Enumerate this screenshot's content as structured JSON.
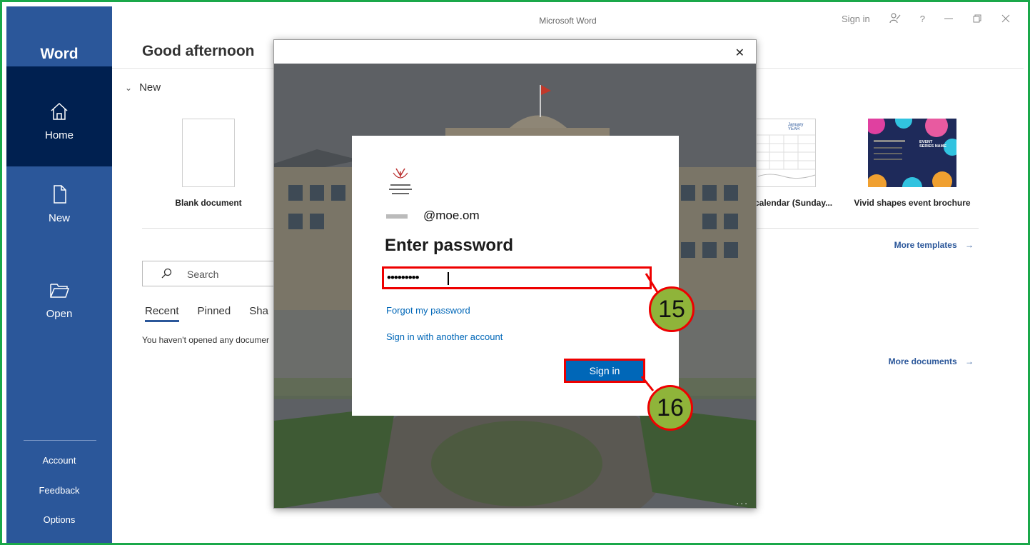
{
  "window": {
    "title": "Microsoft Word",
    "sign_in": "Sign in",
    "help": "?"
  },
  "rail": {
    "app_name": "Word",
    "items": [
      {
        "label": "Home",
        "icon": "home-icon"
      },
      {
        "label": "New",
        "icon": "new-document-icon"
      },
      {
        "label": "Open",
        "icon": "open-folder-icon"
      }
    ],
    "bottom": [
      "Account",
      "Feedback",
      "Options"
    ]
  },
  "greeting": "Good afternoon",
  "new_section": {
    "heading": "New",
    "templates": [
      {
        "name": "Blank document"
      },
      {
        "name": "calendar (Sunday..."
      },
      {
        "name": "Vivid shapes event brochure"
      }
    ],
    "more_templates": "More templates"
  },
  "search": {
    "placeholder": "Search"
  },
  "tabs": [
    "Recent",
    "Pinned",
    "Sha"
  ],
  "empty_message": "You haven't opened any documer",
  "more_documents": "More documents",
  "thumb_text": {
    "calendar_header": "January YEAR",
    "brochure_title": "EVENT SERIES NAME"
  },
  "dialog": {
    "account": "@moe.om",
    "heading": "Enter password",
    "password_value": "•••••••••",
    "forgot": "Forgot my password",
    "another_account": "Sign in with another account",
    "sign_in_button": "Sign in",
    "more": "..."
  },
  "annotations": {
    "step1": "15",
    "step2": "16",
    "highlight_color": "#e00000",
    "badge_color": "#8fb43a"
  },
  "colors": {
    "word_blue": "#2b579a",
    "rail_selected": "#002050",
    "ms_blue": "#0067b8",
    "frame_green": "#1aa84a"
  }
}
